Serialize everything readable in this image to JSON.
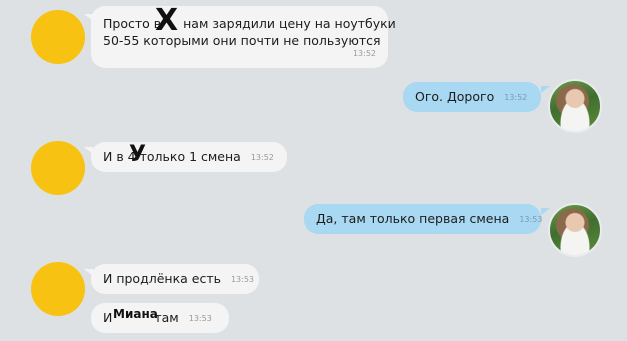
{
  "messages": [
    {
      "line1": "Просто в",
      "line1b": "нам зарядили цену на ноутбуки",
      "line2": "50-55 которыми они почти не пользуются",
      "time": "13:52",
      "mark": "X"
    },
    {
      "text": "Ого. Дорого",
      "time": "13:52"
    },
    {
      "pre": "И в 4",
      "post": "только 1 смена",
      "time": "13:52",
      "mark": "У"
    },
    {
      "text": "Да, там только первая смена",
      "time": "13:53"
    },
    {
      "text": "И продлёнка есть",
      "time": "13:53"
    },
    {
      "pre": "И",
      "post": "там",
      "time": "13:53",
      "mark": "Миана"
    }
  ],
  "colors": {
    "incoming": "#f4f4f4",
    "outgoing": "#a9d8f2",
    "avatar": "#f7c211"
  }
}
